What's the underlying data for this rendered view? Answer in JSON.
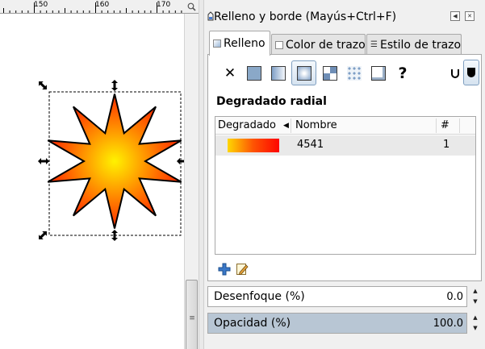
{
  "ruler": {
    "labels": [
      "150",
      "160",
      "170"
    ]
  },
  "dialog": {
    "title": "Relleno y borde (Mayús+Ctrl+F)",
    "tabs": [
      "Relleno",
      "Color de trazo",
      "Estilo de trazo"
    ],
    "paint_types": [
      {
        "name": "no-paint",
        "icon": "x-icon"
      },
      {
        "name": "flat-color",
        "icon": "flat-color-icon"
      },
      {
        "name": "linear-gradient",
        "icon": "linear-gradient-icon"
      },
      {
        "name": "radial-gradient",
        "icon": "radial-gradient-icon",
        "selected": true
      },
      {
        "name": "pattern",
        "icon": "pattern-icon"
      },
      {
        "name": "swatch",
        "icon": "swatch-icon"
      },
      {
        "name": "unset",
        "icon": "question-icon"
      }
    ],
    "fill_rules": [
      {
        "name": "fill-rule-evenodd",
        "icon": "evenodd-icon"
      },
      {
        "name": "fill-rule-nonzero",
        "icon": "nonzero-icon",
        "selected": true
      }
    ],
    "section_title": "Degradado radial",
    "gradient_list": {
      "columns": [
        "Degradado",
        "Nombre",
        "#"
      ],
      "rows": [
        {
          "name": "4541",
          "count": "1",
          "colors": [
            "#fed702",
            "#fe5303",
            "#fe0500"
          ]
        }
      ]
    },
    "blur": {
      "label": "Desenfoque (%)",
      "value": "0.0"
    },
    "opacity": {
      "label": "Opacidad (%)",
      "value": "100.0"
    }
  },
  "canvas": {
    "star": {
      "points": 10,
      "fill_center": "#fff200",
      "fill_edge": "#ff2a00",
      "stroke": "#000000"
    }
  }
}
